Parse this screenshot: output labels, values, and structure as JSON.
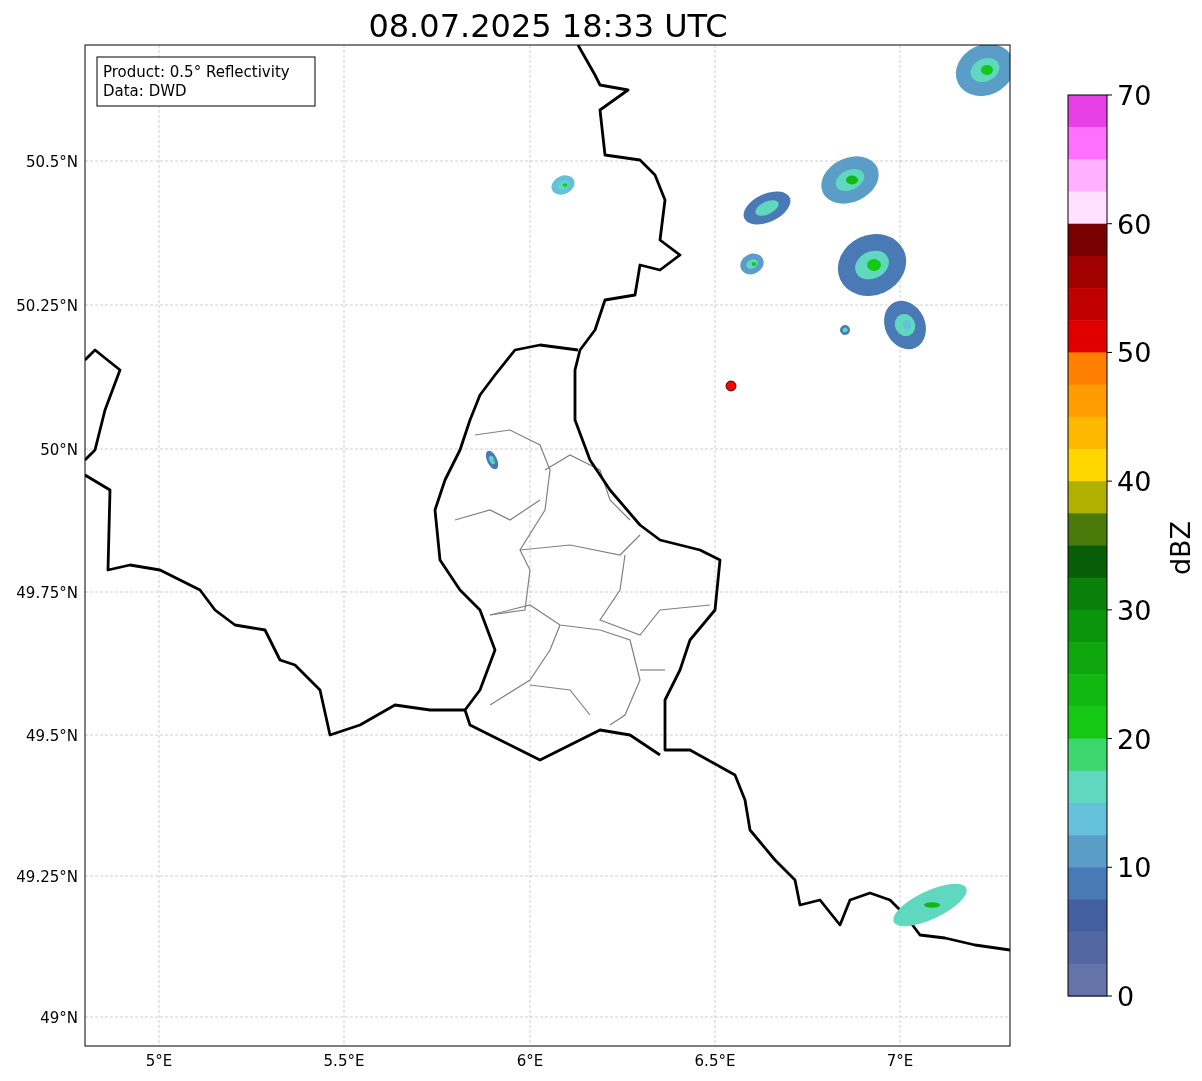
{
  "title": "08.07.2025 18:33 UTC",
  "legend_box": {
    "lines": [
      "Product: 0.5° Reflectivity",
      "Data: DWD"
    ]
  },
  "map": {
    "xticks": [
      "5°E",
      "5.5°E",
      "6°E",
      "6.5°E",
      "7°E"
    ],
    "yticks": [
      "50.5°N",
      "50.25°N",
      "50°N",
      "49.75°N",
      "49.5°N",
      "49.25°N",
      "49°N"
    ]
  },
  "colorbar": {
    "label": "dBZ",
    "ticks": [
      "70",
      "60",
      "50",
      "40",
      "30",
      "20",
      "10",
      "0"
    ],
    "bands": [
      {
        "color": "#e840e8"
      },
      {
        "color": "#ff70ff"
      },
      {
        "color": "#ffb0ff"
      },
      {
        "color": "#ffe0ff"
      },
      {
        "color": "#780000"
      },
      {
        "color": "#a00000"
      },
      {
        "color": "#c00000"
      },
      {
        "color": "#e00000"
      },
      {
        "color": "#ff8000"
      },
      {
        "color": "#ff9c00"
      },
      {
        "color": "#ffb800"
      },
      {
        "color": "#ffd700"
      },
      {
        "color": "#b0b000"
      },
      {
        "color": "#4a7a0a"
      },
      {
        "color": "#085e08"
      },
      {
        "color": "#0a800a"
      },
      {
        "color": "#0a960a"
      },
      {
        "color": "#0ea80e"
      },
      {
        "color": "#10b810"
      },
      {
        "color": "#14c814"
      },
      {
        "color": "#3ed66e"
      },
      {
        "color": "#60d8c0"
      },
      {
        "color": "#65c0dc"
      },
      {
        "color": "#5a9ec8"
      },
      {
        "color": "#4a7ab5"
      },
      {
        "color": "#4460a0"
      },
      {
        "color": "#5467a0"
      },
      {
        "color": "#6574a8"
      }
    ]
  }
}
